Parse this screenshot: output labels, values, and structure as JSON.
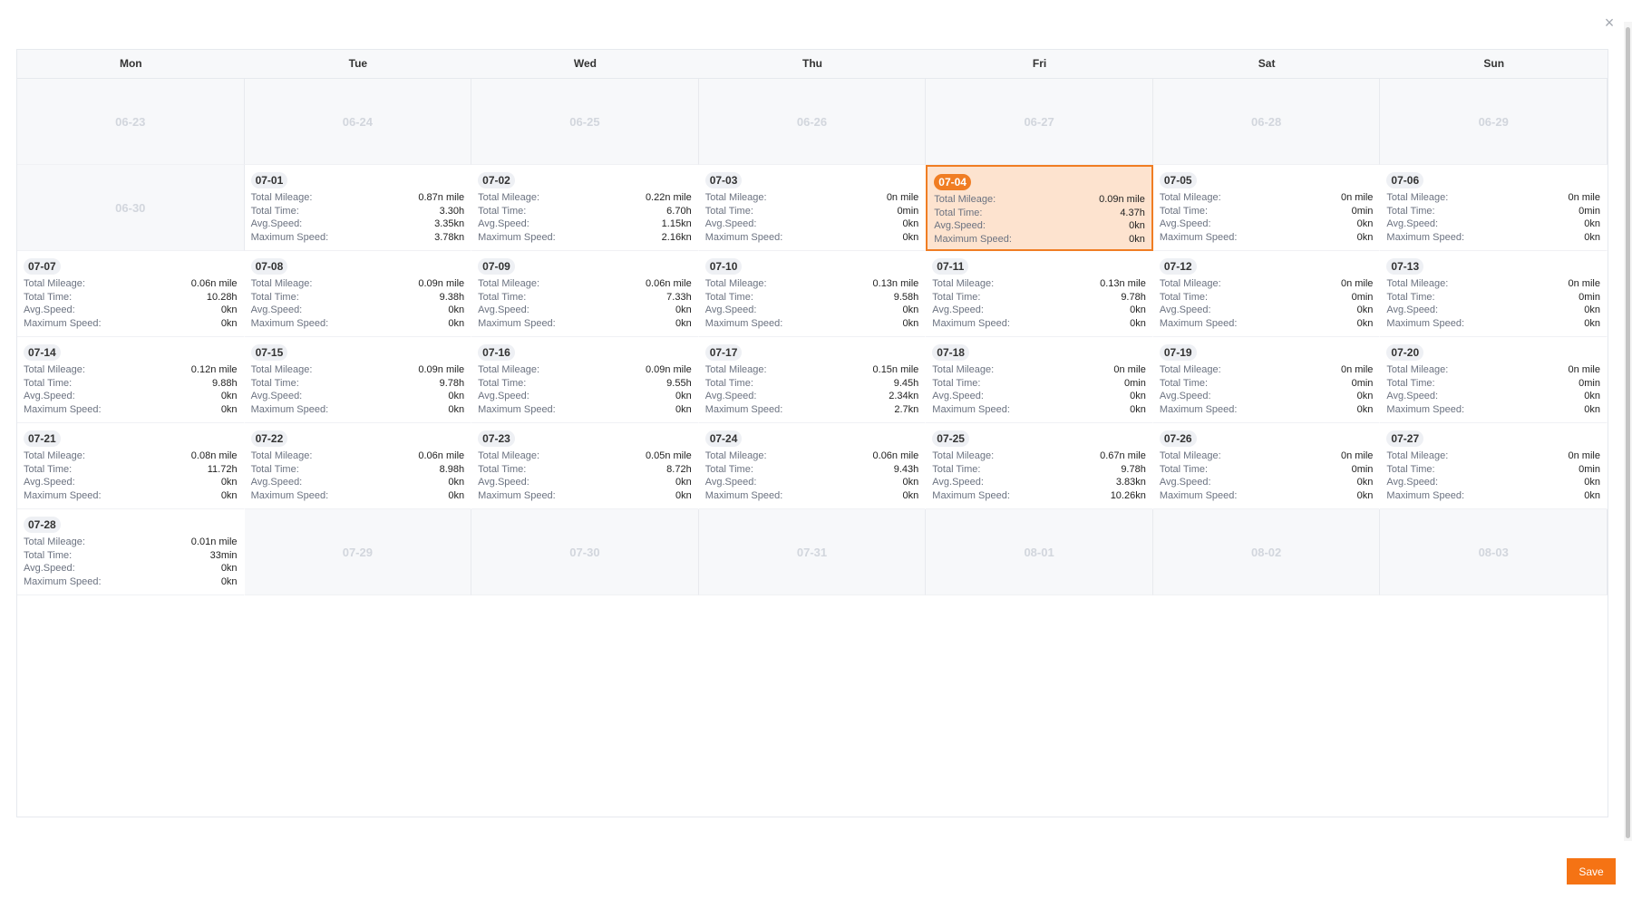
{
  "close_icon": "×",
  "weekdays": [
    "Mon",
    "Tue",
    "Wed",
    "Thu",
    "Fri",
    "Sat",
    "Sun"
  ],
  "labels": {
    "total_mileage": "Total Mileage:",
    "total_time": "Total Time:",
    "avg_speed": "Avg.Speed:",
    "max_speed": "Maximum Speed:"
  },
  "save_label": "Save",
  "accent_color": "#f07d23",
  "selected_date": "07-04",
  "days": [
    {
      "date": "06-23",
      "other": true
    },
    {
      "date": "06-24",
      "other": true
    },
    {
      "date": "06-25",
      "other": true
    },
    {
      "date": "06-26",
      "other": true
    },
    {
      "date": "06-27",
      "other": true
    },
    {
      "date": "06-28",
      "other": true
    },
    {
      "date": "06-29",
      "other": true
    },
    {
      "date": "06-30",
      "other": true
    },
    {
      "date": "07-01",
      "mileage": "0.87n mile",
      "time": "3.30h",
      "avg": "3.35kn",
      "max": "3.78kn"
    },
    {
      "date": "07-02",
      "mileage": "0.22n mile",
      "time": "6.70h",
      "avg": "1.15kn",
      "max": "2.16kn"
    },
    {
      "date": "07-03",
      "mileage": "0n mile",
      "time": "0min",
      "avg": "0kn",
      "max": "0kn"
    },
    {
      "date": "07-04",
      "mileage": "0.09n mile",
      "time": "4.37h",
      "avg": "0kn",
      "max": "0kn",
      "selected": true
    },
    {
      "date": "07-05",
      "mileage": "0n mile",
      "time": "0min",
      "avg": "0kn",
      "max": "0kn"
    },
    {
      "date": "07-06",
      "mileage": "0n mile",
      "time": "0min",
      "avg": "0kn",
      "max": "0kn"
    },
    {
      "date": "07-07",
      "mileage": "0.06n mile",
      "time": "10.28h",
      "avg": "0kn",
      "max": "0kn"
    },
    {
      "date": "07-08",
      "mileage": "0.09n mile",
      "time": "9.38h",
      "avg": "0kn",
      "max": "0kn"
    },
    {
      "date": "07-09",
      "mileage": "0.06n mile",
      "time": "7.33h",
      "avg": "0kn",
      "max": "0kn"
    },
    {
      "date": "07-10",
      "mileage": "0.13n mile",
      "time": "9.58h",
      "avg": "0kn",
      "max": "0kn"
    },
    {
      "date": "07-11",
      "mileage": "0.13n mile",
      "time": "9.78h",
      "avg": "0kn",
      "max": "0kn"
    },
    {
      "date": "07-12",
      "mileage": "0n mile",
      "time": "0min",
      "avg": "0kn",
      "max": "0kn"
    },
    {
      "date": "07-13",
      "mileage": "0n mile",
      "time": "0min",
      "avg": "0kn",
      "max": "0kn"
    },
    {
      "date": "07-14",
      "mileage": "0.12n mile",
      "time": "9.88h",
      "avg": "0kn",
      "max": "0kn"
    },
    {
      "date": "07-15",
      "mileage": "0.09n mile",
      "time": "9.78h",
      "avg": "0kn",
      "max": "0kn"
    },
    {
      "date": "07-16",
      "mileage": "0.09n mile",
      "time": "9.55h",
      "avg": "0kn",
      "max": "0kn"
    },
    {
      "date": "07-17",
      "mileage": "0.15n mile",
      "time": "9.45h",
      "avg": "2.34kn",
      "max": "2.7kn"
    },
    {
      "date": "07-18",
      "mileage": "0n mile",
      "time": "0min",
      "avg": "0kn",
      "max": "0kn"
    },
    {
      "date": "07-19",
      "mileage": "0n mile",
      "time": "0min",
      "avg": "0kn",
      "max": "0kn"
    },
    {
      "date": "07-20",
      "mileage": "0n mile",
      "time": "0min",
      "avg": "0kn",
      "max": "0kn"
    },
    {
      "date": "07-21",
      "mileage": "0.08n mile",
      "time": "11.72h",
      "avg": "0kn",
      "max": "0kn"
    },
    {
      "date": "07-22",
      "mileage": "0.06n mile",
      "time": "8.98h",
      "avg": "0kn",
      "max": "0kn"
    },
    {
      "date": "07-23",
      "mileage": "0.05n mile",
      "time": "8.72h",
      "avg": "0kn",
      "max": "0kn"
    },
    {
      "date": "07-24",
      "mileage": "0.06n mile",
      "time": "9.43h",
      "avg": "0kn",
      "max": "0kn"
    },
    {
      "date": "07-25",
      "mileage": "0.67n mile",
      "time": "9.78h",
      "avg": "3.83kn",
      "max": "10.26kn"
    },
    {
      "date": "07-26",
      "mileage": "0n mile",
      "time": "0min",
      "avg": "0kn",
      "max": "0kn"
    },
    {
      "date": "07-27",
      "mileage": "0n mile",
      "time": "0min",
      "avg": "0kn",
      "max": "0kn"
    },
    {
      "date": "07-28",
      "mileage": "0.01n mile",
      "time": "33min",
      "avg": "0kn",
      "max": "0kn"
    },
    {
      "date": "07-29",
      "other": true
    },
    {
      "date": "07-30",
      "other": true
    },
    {
      "date": "07-31",
      "other": true
    },
    {
      "date": "08-01",
      "other": true
    },
    {
      "date": "08-02",
      "other": true
    },
    {
      "date": "08-03",
      "other": true
    }
  ]
}
